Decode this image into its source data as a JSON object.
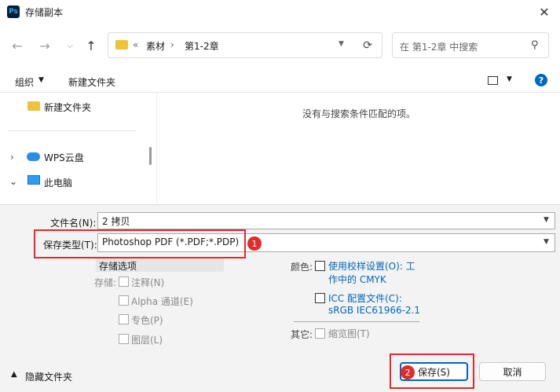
{
  "window": {
    "title": "存储副本",
    "app_icon": "Ps",
    "close": "✕"
  },
  "nav": {
    "address": {
      "chevron": "«",
      "crumbs": [
        "素材",
        "第1-2章"
      ],
      "separator": "›"
    },
    "search_placeholder": "在 第1-2章 中搜索"
  },
  "toolbar": {
    "organize": "组织",
    "new_folder": "新建文件夹"
  },
  "sidebar": {
    "items": [
      "新建文件夹",
      "WPS云盘",
      "此电脑"
    ]
  },
  "content": {
    "empty_message": "没有与搜索条件匹配的项。"
  },
  "form": {
    "filename_label": "文件名(N):",
    "filename_value": "2 拷贝",
    "filetype_label": "保存类型(T):",
    "filetype_value": "Photoshop PDF (*.PDF;*.PDP)"
  },
  "options": {
    "title": "存储选项",
    "save_label": "存储:",
    "save_items": [
      "注释(N)",
      "Alpha 通道(E)",
      "专色(P)",
      "图层(L)"
    ],
    "color_label": "颜色:",
    "proof_setup": [
      "使用校样设置(O):  工",
      "作中的 CMYK"
    ],
    "icc_profile": [
      "ICC 配置文件(C):",
      "sRGB IEC61966-2.1"
    ],
    "other_label": "其它:",
    "thumbnail": "缩览图(T)"
  },
  "footer": {
    "hide_folders": "隐藏文件夹",
    "save": "保存(S)",
    "cancel": "取消"
  },
  "annotations": {
    "badge1": "1",
    "badge2": "2"
  },
  "colors": {
    "accent": "#0067c0",
    "highlight": "#e12b2b",
    "folder": "#f0c23b"
  }
}
